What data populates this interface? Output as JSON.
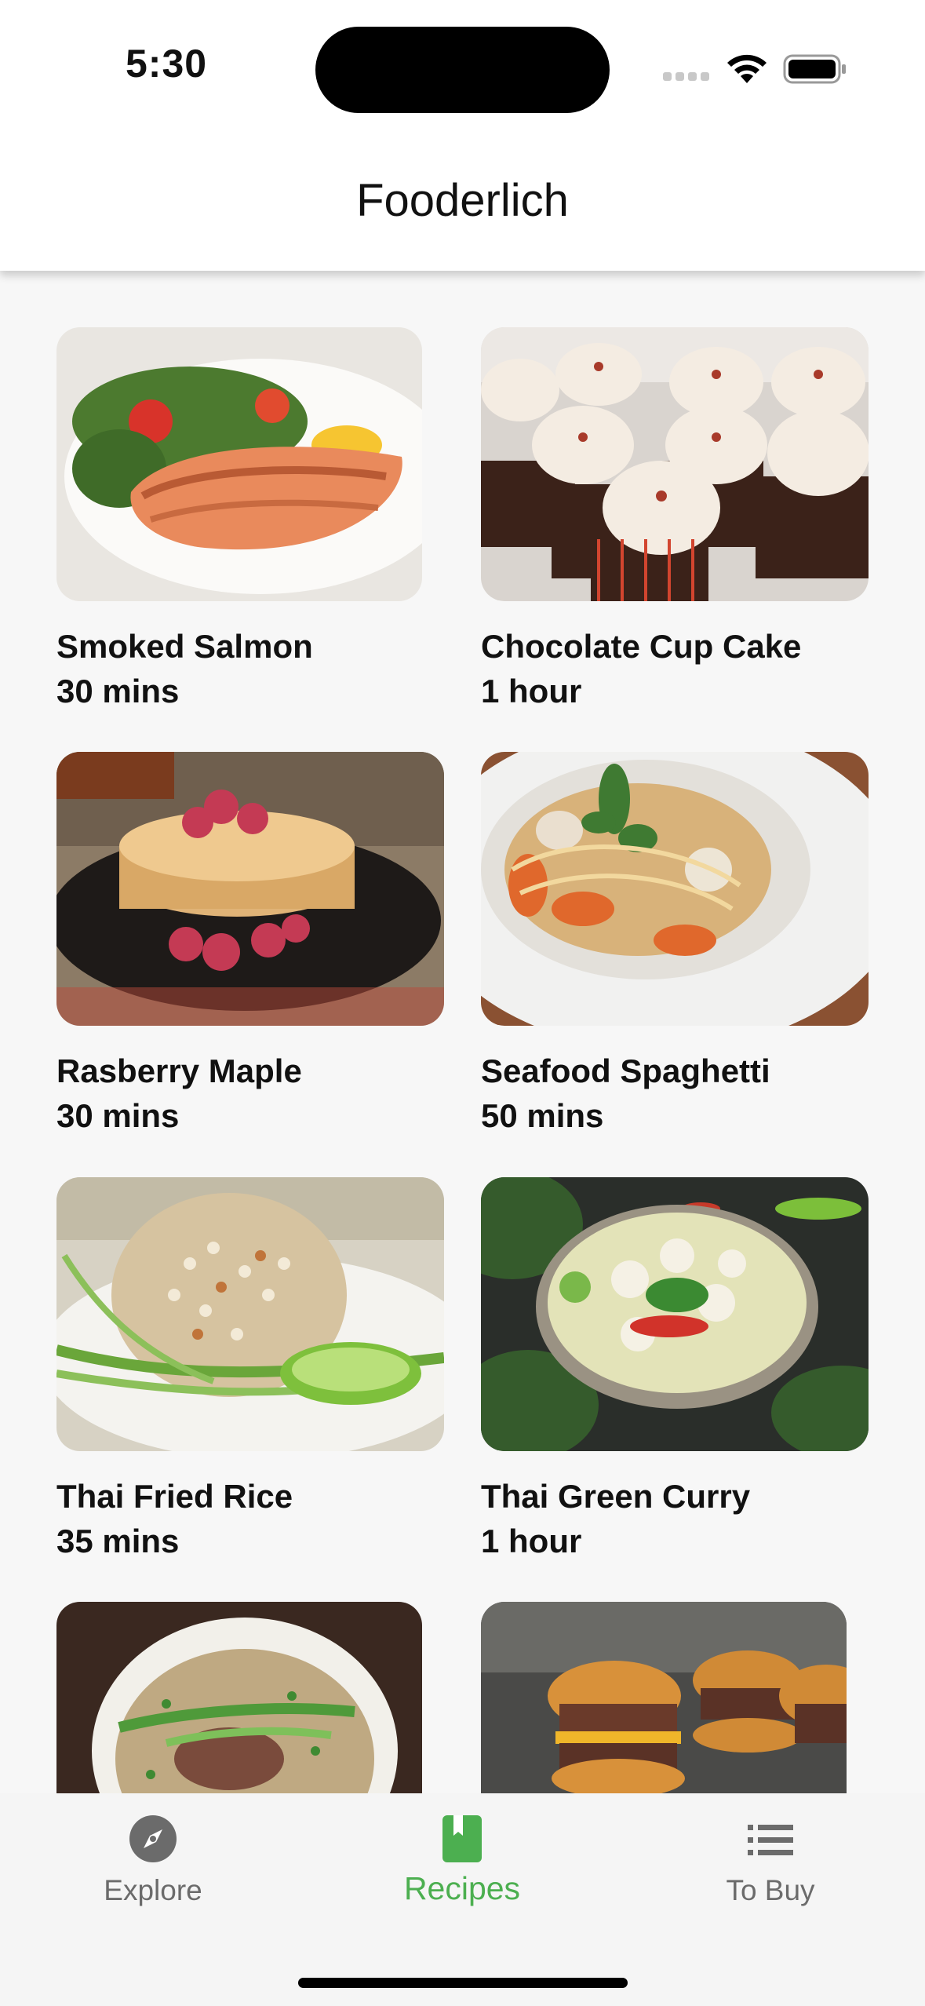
{
  "status_bar": {
    "time": "5:30"
  },
  "header": {
    "title": "Fooderlich"
  },
  "recipes": [
    {
      "title": "Smoked Salmon",
      "duration": "30 mins"
    },
    {
      "title": "Chocolate Cup Cake",
      "duration": "1 hour"
    },
    {
      "title": "Rasberry Maple",
      "duration": "30 mins"
    },
    {
      "title": "Seafood Spaghetti",
      "duration": "50 mins"
    },
    {
      "title": "Thai Fried Rice",
      "duration": "35 mins"
    },
    {
      "title": "Thai Green Curry",
      "duration": "1 hour"
    }
  ],
  "tab_bar": {
    "tabs": [
      {
        "label": "Explore",
        "icon": "compass-icon",
        "active": false
      },
      {
        "label": "Recipes",
        "icon": "book-icon",
        "active": true
      },
      {
        "label": "To Buy",
        "icon": "list-icon",
        "active": false
      }
    ],
    "active_color": "#4caf50",
    "inactive_color": "#6b6b6b"
  }
}
